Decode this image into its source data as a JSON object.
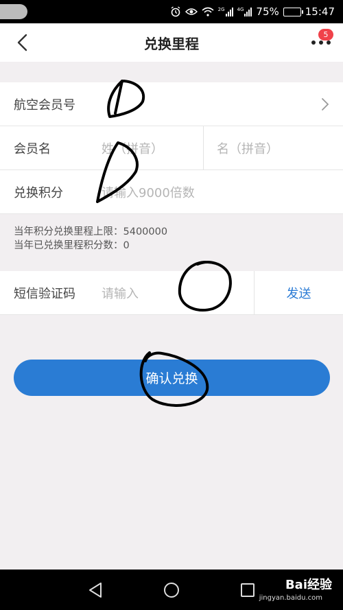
{
  "status_bar": {
    "net_1": "2G",
    "net_2": "4G",
    "battery": "75%",
    "time": "15:47"
  },
  "header": {
    "title": "兑换里程",
    "badge_count": "5"
  },
  "form": {
    "member_number_label": "航空会员号",
    "member_name_label": "会员名",
    "surname_placeholder": "姓（拼音）",
    "given_name_placeholder": "名（拼音）",
    "points_label": "兑换积分",
    "points_placeholder": "请输入9000倍数",
    "annual_limit_text": "当年积分兑换里程上限：5400000",
    "redeemed_text": "当年已兑换里程积分数：0",
    "sms_label": "短信验证码",
    "sms_placeholder": "请输入",
    "send_label": "发送"
  },
  "confirm_label": "确认兑换",
  "watermark": {
    "brand": "Bai经验",
    "site": "jingyan.baidu.com"
  },
  "colors": {
    "accent": "#2a7cd4",
    "badge": "#f0424a",
    "background": "#f2eff1"
  },
  "icons": [
    "back-icon",
    "more-icon",
    "chevron-right-icon",
    "nav-back-icon",
    "nav-home-icon",
    "nav-recents-icon"
  ]
}
